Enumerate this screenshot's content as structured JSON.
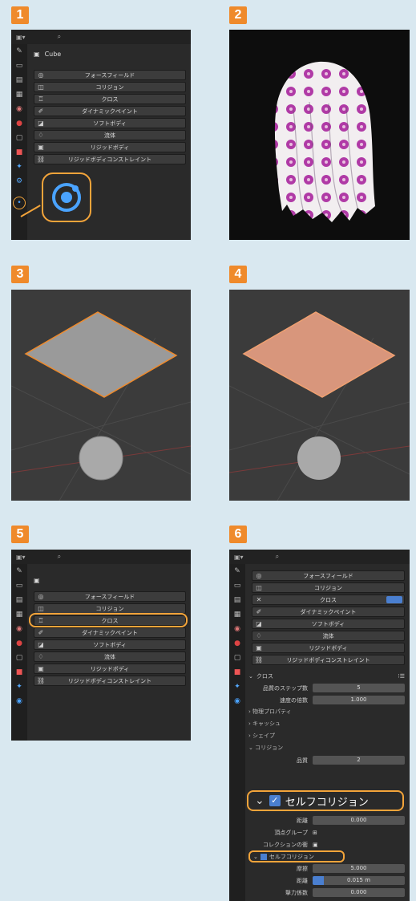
{
  "steps": [
    "1",
    "2",
    "3",
    "4",
    "5",
    "6"
  ],
  "colors": {
    "accent": "#ef8a2b",
    "highlight": "#f3a43a",
    "panel": "#2a2a2a",
    "cloth_pattern": "#b03aa6",
    "plane_selected": "#d8967c"
  },
  "panel1": {
    "object_name": "Cube",
    "physics_buttons": [
      "フォースフィールド",
      "コリジョン",
      "クロス",
      "ダイナミックペイント",
      "ソフトボディ",
      "流体",
      "リジッドボディ",
      "リジッドボディコンストレイント"
    ],
    "icons": [
      "tool-icon",
      "render-icon",
      "output-icon",
      "view-layer-icon",
      "scene-icon",
      "world-icon",
      "object-icon",
      "modifier-icon",
      "particles-icon",
      "physics-icon"
    ]
  },
  "panel5": {
    "physics_buttons": [
      "フォースフィールド",
      "コリジョン",
      "クロス",
      "ダイナミックペイント",
      "ソフトボディ",
      "流体",
      "リジッドボディ",
      "リジッドボディコンストレイント"
    ],
    "highlighted": "クロス"
  },
  "panel6": {
    "physics_buttons": [
      "フォースフィールド",
      "コリジョン",
      "クロス",
      "ダイナミックペイント",
      "ソフトボディ",
      "流体",
      "リジッドボディ",
      "リジッドボディコンストレイント"
    ],
    "cloth_header": "クロス",
    "quality_label": "品質のステップ数",
    "quality_value": "5",
    "speed_label": "速度の倍数",
    "speed_value": "1.000",
    "sections": [
      "物理プロパティ",
      "キャッシュ",
      "シェイプ",
      "コリジョン"
    ],
    "quality2_label": "品質",
    "quality2_value": "2",
    "self_collision_large": "セルフコリジョン",
    "distance_label": "距離",
    "distance_value": "0.000",
    "vertex_group_label": "頂点グループ",
    "collection_label": "コレクションの衝",
    "self_collision_small": "セルフコリジョン",
    "friction_label": "摩擦",
    "friction_value": "5.000",
    "distance2_label": "距離",
    "distance2_value": "0.015 m",
    "impulse_label": "撃力係数",
    "impulse_value": "0.000"
  }
}
